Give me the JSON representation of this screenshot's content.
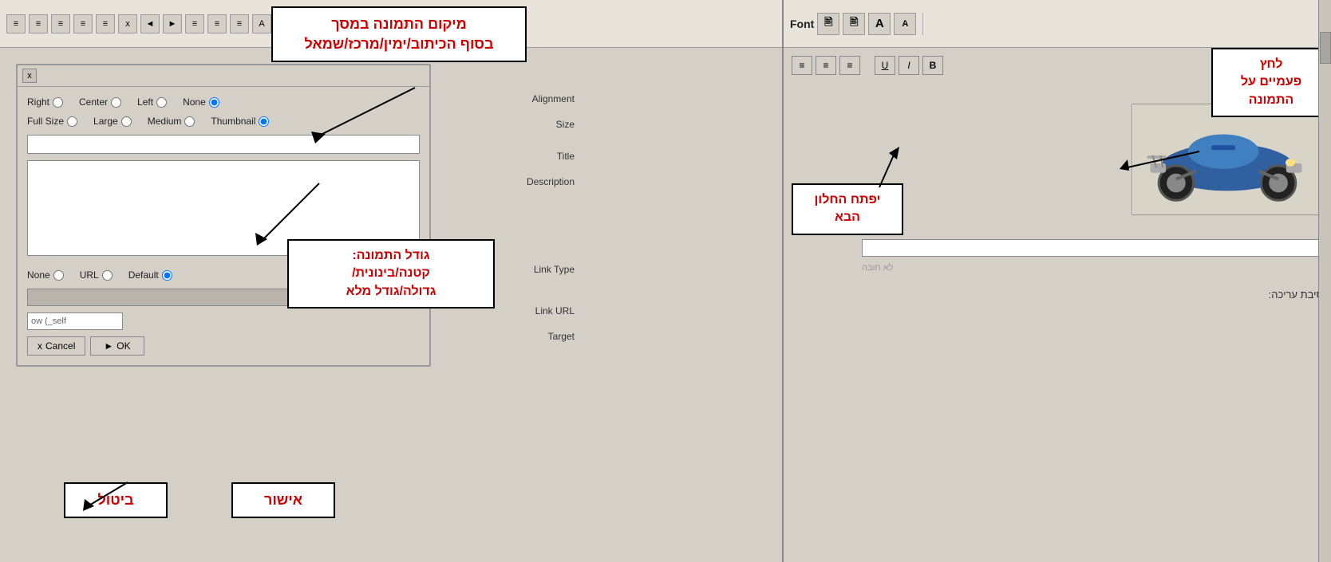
{
  "toolbar": {
    "font_label": "Font",
    "underline_label": "U",
    "italic_label": "I",
    "bold_label": "B"
  },
  "dialog": {
    "title": "x",
    "close_btn": "x",
    "alignment": {
      "label": "Alignment",
      "options": [
        "Right",
        "Center",
        "Left",
        "None"
      ],
      "selected": "None"
    },
    "size": {
      "label": "Size",
      "options": [
        "Full Size",
        "Large",
        "Medium",
        "Thumbnail"
      ],
      "selected": "Thumbnail"
    },
    "title_label": "Title",
    "description_label": "Description",
    "link_type": {
      "label": "Link Type",
      "options": [
        "None",
        "URL",
        "Default"
      ],
      "selected": "Default"
    },
    "link_url_label": "Link URL",
    "target_label": "Target",
    "target_value": "ow (_self",
    "cancel_btn": "Cancel",
    "ok_btn": "OK"
  },
  "annotations": {
    "top_annotation": "מיקום התמונה במסך\nבסוף הכיתוב/ימין/מרכז/שמאל",
    "bottom_annotation_label": "אישור",
    "cancel_annotation_label": "ביטול",
    "size_annotation": "גודל התמונה:\nקטנה/בינונית/\nגדולה/גודל מלא",
    "next_window_annotation": "יפתח החלון\nהבא",
    "right_annotation": "לחץ\nפעמיים על\nהתמונה"
  },
  "right_panel": {
    "align_buttons": [
      "≡",
      "≡",
      "≡"
    ],
    "format_buttons": [
      "U",
      "I",
      "B"
    ],
    "link_url_field": "",
    "link_url_placeholder": "",
    "lo_chova": "לא חובה",
    "hebrew_label": "סיבת עריכה:"
  }
}
